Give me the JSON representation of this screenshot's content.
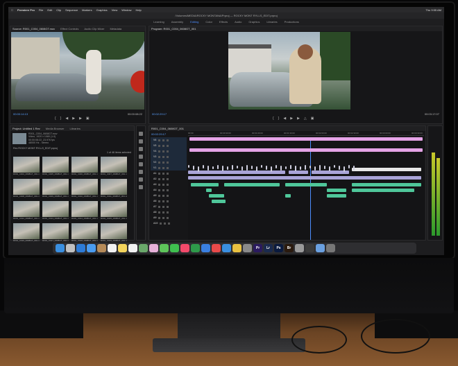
{
  "menubar": {
    "app": "Premiere Pro",
    "items": [
      "File",
      "Edit",
      "Clip",
      "Sequence",
      "Markers",
      "Graphics",
      "View",
      "Window",
      "Help"
    ],
    "clock": "Thu 9:55 AM"
  },
  "window_title": "/Volumes/MEDIA/ROCKY MONTANA/Prproj — ROCKY MONT RYLLS_EDIT.prproj",
  "workspaces": {
    "tabs": [
      "Learning",
      "Assembly",
      "Editing",
      "Color",
      "Effects",
      "Audio",
      "Graphics",
      "Libraries",
      "Productions"
    ],
    "active_index": 2
  },
  "source": {
    "tabs": [
      "Source: R001_C004_0608GT.mov",
      "Effect Controls",
      "Audio Clip Mixer",
      "Metadata",
      "Audio Track M"
    ],
    "timecode_in": "00:00:14:13",
    "timecode_dur": "00:00:08:22"
  },
  "program": {
    "tabs": [
      "Program: R001_C004_0608GT_001"
    ],
    "timecode": "00:02:29:17",
    "duration": "00:03:17:07"
  },
  "project": {
    "tabs": [
      "Project: Untitled 1 Rev",
      "Media Browser",
      "Libraries",
      "Info",
      "Effects"
    ],
    "info_lines": [
      "R001_C004_0608GT.mov",
      "Video, 1920 x 1080 (1.0)",
      "00:00:08:22, 23.976 fps",
      "48000 Hz - Stereo"
    ],
    "path": "Rev ROCKY MONT RYLLS_EDIT.prproj",
    "item_count": "1 of 46 items selected",
    "thumbs": [
      "R001_C004_0608GT_001.mov",
      "R001_C005_0608GT_001.mov",
      "R001_C006_0608GT_001.mov",
      "R001_C007_0608GT_001.mov",
      "R001_C008_0608GT_001.mov",
      "R001_C009_0608GT_001.mov",
      "R001_C010_0608GT_001.mov",
      "R001_C011_0608GT_001.mov",
      "R001_C012_0608GT_001.mov",
      "R001_C013_0608GT_001.mov",
      "R001_C014_0608GT_001.mov",
      "R001_C015_0608GT_001.mov",
      "R001_C016_0608GT_001.mov",
      "R001_C017_0608GT_001.mov",
      "R001_C018_0608GT_001.mov",
      "R001_C019_0608GT_001.mov"
    ]
  },
  "timeline": {
    "tab": "R001_C004_0608GT_001",
    "timecode": "00:02:29:17",
    "ruler": [
      "00:00",
      "00:00:30:00",
      "00:01:00:00",
      "00:01:30:00",
      "00:02:00:00",
      "00:02:30:00",
      "00:03:00:00",
      "00:03:30:00"
    ],
    "tracks": [
      "V6",
      "V5",
      "V4",
      "V3",
      "V2",
      "V1",
      "A1",
      "A2",
      "A3",
      "A4",
      "A5",
      "A6",
      "A7",
      "A8",
      "A9",
      "A10"
    ]
  },
  "dock": {
    "icons": [
      "finder",
      "launchpad",
      "safari",
      "mail",
      "contacts",
      "calendar",
      "notes",
      "reminders",
      "maps",
      "photos",
      "messages",
      "facetime",
      "music",
      "numbers",
      "keynote",
      "news",
      "app-store",
      "chrome",
      "preferences",
      "premiere",
      "lightroom",
      "photoshop",
      "bridge",
      "disk-utility",
      "quicktime",
      "preview",
      "trash"
    ],
    "labels": {
      "premiere": "Pr",
      "lightroom": "Lr",
      "photoshop": "Ps",
      "bridge": "Br"
    }
  },
  "colors": {
    "accent": "#4d8eff",
    "clip_pink": "#e4a3e6",
    "clip_audio": "#4fc79a",
    "clip_video": "#a9a4d8"
  }
}
